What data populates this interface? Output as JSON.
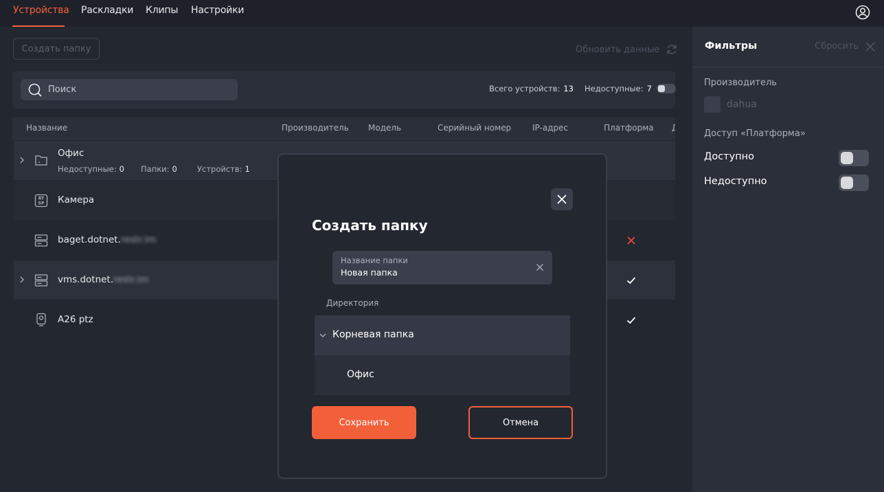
{
  "nav": {
    "tabs": [
      {
        "label": "Устройства",
        "active": true
      },
      {
        "label": "Раскладки",
        "active": false
      },
      {
        "label": "Клипы",
        "active": false
      },
      {
        "label": "Настройки",
        "active": false
      }
    ],
    "user_icon": "user-circle-icon"
  },
  "toolbar": {
    "create_folder_label": "Создать папку",
    "refresh_label": "Обновить данные"
  },
  "search": {
    "placeholder": "Поиск",
    "total_label": "Всего устройств:",
    "total_value": "13",
    "unavailable_label": "Недоступные:",
    "unavailable_value": "7"
  },
  "table": {
    "columns": [
      "Название",
      "Производитель",
      "Модель",
      "Серийный номер",
      "IP-адрес",
      "Платформа",
      "Д"
    ],
    "rows": [
      {
        "name": "Офис",
        "type": "folder",
        "expandable": true,
        "stats": {
          "unavailable_label": "Недоступные:",
          "unavailable_value": "0",
          "folders_label": "Папки:",
          "folders_value": "0",
          "devices_label": "Устройств:",
          "devices_value": "1"
        }
      },
      {
        "name": "Камера",
        "type": "rtsp",
        "expandable": false,
        "platform": ""
      },
      {
        "name_visible": "baget.dotnet.",
        "name_blurred": "restr.im",
        "type": "server",
        "expandable": false,
        "platform": "cross"
      },
      {
        "name_visible": "vms.dotnet.",
        "name_blurred": "restr.im",
        "type": "server",
        "expandable": true,
        "platform": "check"
      },
      {
        "name": "A26 ptz",
        "type": "camera",
        "expandable": false,
        "platform": "check"
      }
    ]
  },
  "filters": {
    "title": "Фильтры",
    "reset_label": "Сбросить",
    "manufacturer_label": "Производитель",
    "manufacturer_option": "dahua",
    "access_label": "Доступ «Платформа»",
    "available_label": "Доступно",
    "unavailable_label": "Недоступно"
  },
  "modal": {
    "title": "Создать папку",
    "field_label": "Название папки",
    "field_value": "Новая папка",
    "directory_label": "Директория",
    "tree_root": "Корневая папка",
    "tree_child": "Офис",
    "save_label": "Сохранить",
    "cancel_label": "Отмена"
  },
  "colors": {
    "accent": "#f2603a",
    "background": "#232730",
    "panel": "#2b2f39",
    "error": "#e8473a"
  }
}
